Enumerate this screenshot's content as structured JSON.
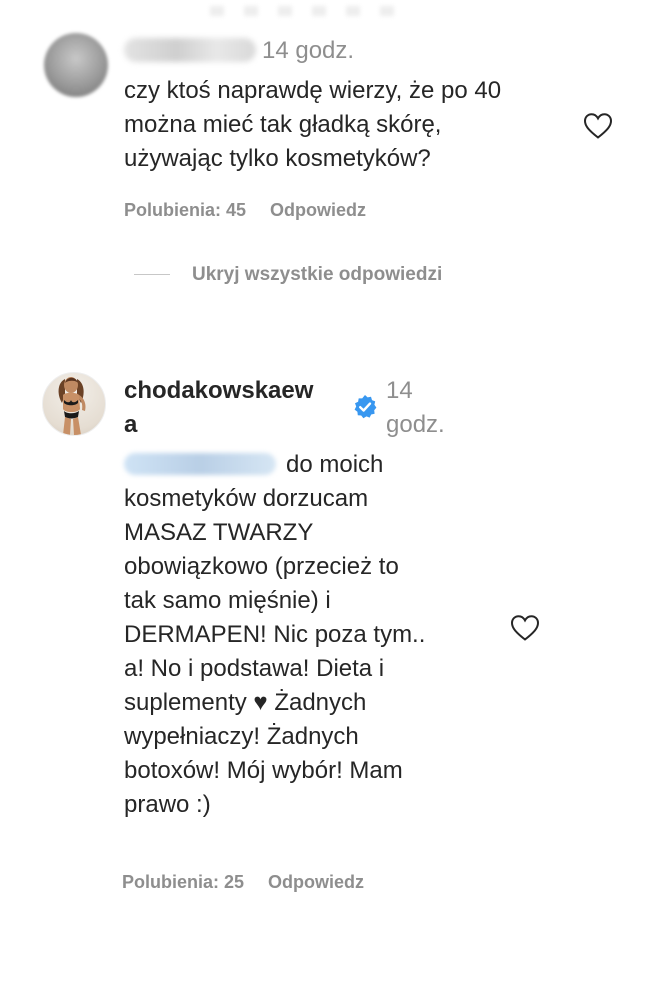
{
  "comment1": {
    "time": "14 godz.",
    "text_lines": [
      "czy ktoś naprawdę wierzy, że po 40",
      "można mieć tak gładką skórę,",
      "używając tylko kosmetyków?"
    ],
    "likes_label": "Polubienia: 45",
    "reply_label": "Odpowiedz"
  },
  "replies_toggle_label": "Ukryj wszystkie odpowiedzi",
  "comment2": {
    "username_line1": "chodakowskaew",
    "username_line2": "a",
    "time_line1": "14",
    "time_line2": "godz.",
    "first_line_after_mention": "do moich",
    "text_lines": [
      "kosmetyków dorzucam",
      "MASAZ TWARZY",
      "obowiązkowo (przecież to",
      "tak samo mięśnie) i",
      "DERMAPEN! Nic poza tym..",
      "a! No i podstawa! Dieta i",
      "suplementy ♥ Żadnych",
      "wypełniaczy! Żadnych",
      "botoxów! Mój wybór! Mam",
      "prawo :)"
    ],
    "likes_label": "Polubienia: 25",
    "reply_label": "Odpowiedz"
  },
  "icons": {
    "like": "heart-outline-icon",
    "verified": "verified-badge-icon"
  },
  "colors": {
    "text": "#262626",
    "secondary": "#8e8e8e",
    "verified": "#3897f0"
  }
}
